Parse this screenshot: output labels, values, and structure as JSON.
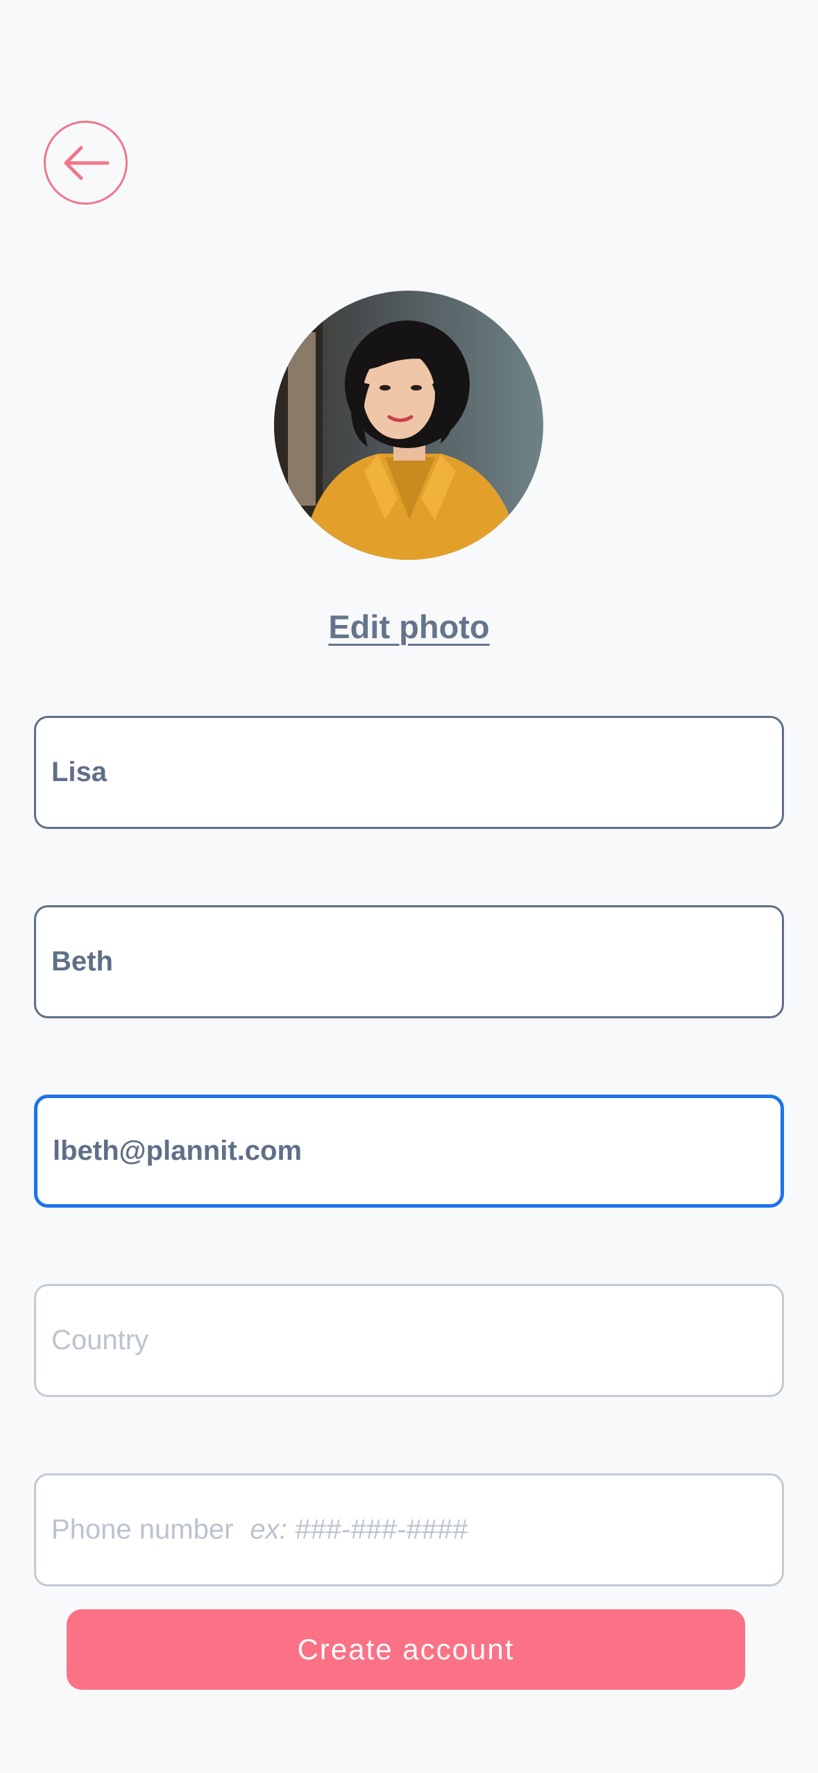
{
  "header": {
    "back_icon": "arrow-left-icon"
  },
  "profile": {
    "photo_alt": "Profile photo",
    "edit_photo_label": "Edit photo"
  },
  "form": {
    "first_name": {
      "value": "Lisa"
    },
    "last_name": {
      "value": "Beth"
    },
    "email": {
      "value": "lbeth@plannit.com"
    },
    "country": {
      "placeholder": "Country"
    },
    "phone": {
      "placeholder": "Phone number",
      "hint": "ex: ###-###-####"
    }
  },
  "actions": {
    "create_account_label": "Create account"
  },
  "colors": {
    "accent": "#fb7186",
    "back_ring": "#f0768a",
    "focus": "#1d74e8",
    "text": "#5f6f87",
    "placeholder": "#bcc3ce",
    "background": "#f8f9fb"
  }
}
